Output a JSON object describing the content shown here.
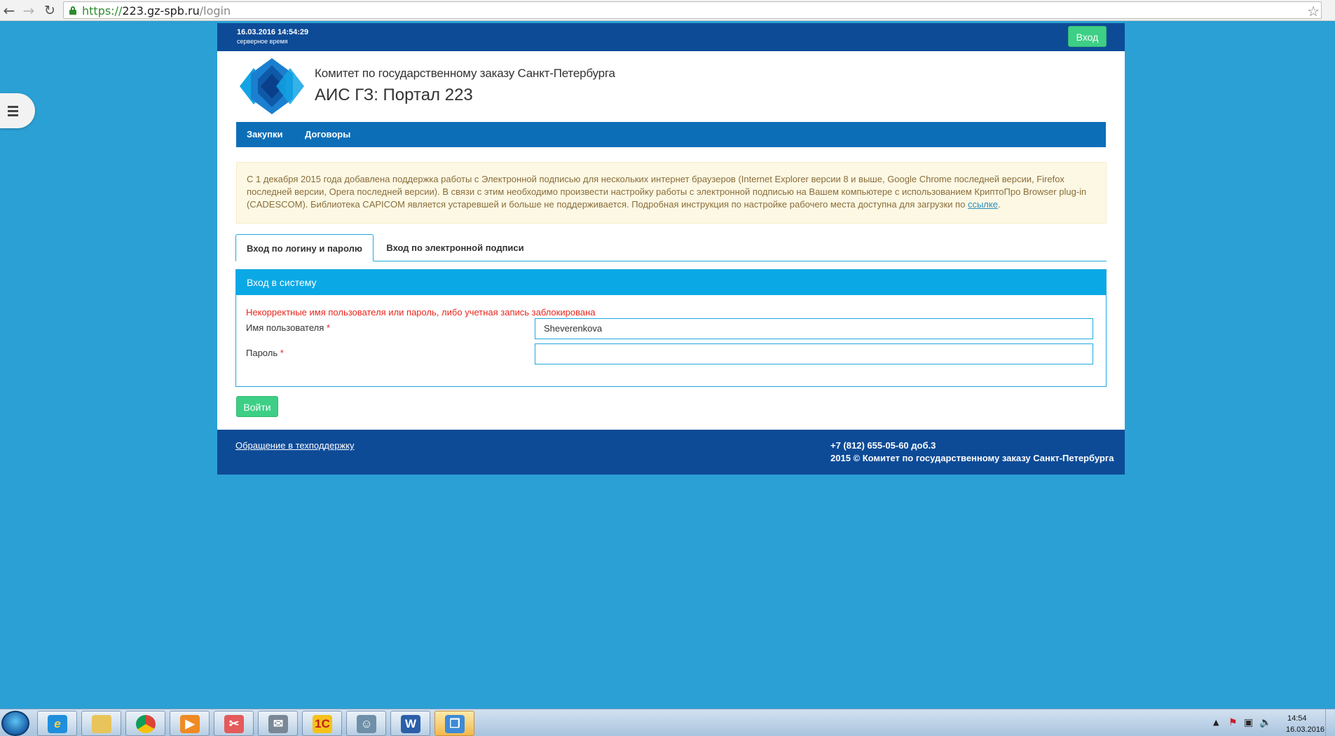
{
  "browser": {
    "url_scheme": "https://",
    "url_host": "223.gz-spb.ru",
    "url_path": "/login"
  },
  "topbar": {
    "server_time": "16.03.2016 14:54:29",
    "server_time_label": "серверное время",
    "login_button": "Вход"
  },
  "header": {
    "org_name": "Комитет по государственному заказу Санкт-Петербурга",
    "portal_name": "АИС ГЗ: Портал 223"
  },
  "menu": {
    "items": [
      "Закупки",
      "Договоры"
    ]
  },
  "notice": {
    "text": "С 1 декабря 2015 года добавлена поддержка работы с Электронной подписью для нескольких интернет браузеров (Internet Explorer версии 8 и выше, Google Chrome последней версии, Firefox последней версии, Opera последней версии). В связи с этим необходимо произвести настройку работы с электронной подписью на Вашем компьютере с использованием КриптоПро Browser plug-in (CADESCOM). Библиотека CAPICOM является устаревшей и больше не поддерживается. Подробная инструкция по настройке рабочего места доступна для загрузки по ",
    "link": "ссылке",
    "suffix": "."
  },
  "tabs": {
    "login_password": "Вход по логину и паролю",
    "digital_signature": "Вход по электронной подписи"
  },
  "login_panel": {
    "title": "Вход в систему",
    "error": "Некорректные имя пользователя или пароль, либо учетная запись заблокирована",
    "username_label": "Имя пользователя",
    "username_value": "Sheverenkova",
    "password_label": "Пароль",
    "password_value": "",
    "required_mark": "*",
    "submit": "Войти"
  },
  "footer": {
    "support_link": "Обращение в техподдержку",
    "phone": "+7 (812) 655-05-60 доб.3",
    "copyright": "2015 © Комитет по государственному заказу Санкт-Петербурга"
  },
  "taskbar": {
    "apps": [
      "internet-explorer-icon",
      "file-explorer-icon",
      "chrome-icon",
      "media-player-icon",
      "snipping-tool-icon",
      "mail-icon",
      "1c-icon",
      "user-app-icon",
      "word-icon",
      "windows-explorer-icon"
    ],
    "app_labels": {
      "ie": "e",
      "one_c": "1С",
      "word": "W"
    },
    "clock_time": "14:54",
    "clock_date": "16.03.2016"
  },
  "colors": {
    "background": "#2ba0d4",
    "topbar": "#0d4b97",
    "menu": "#0d6eb8",
    "accent": "#0aa9e6",
    "button_green": "#3dcf85",
    "error_red": "#e8251c"
  }
}
